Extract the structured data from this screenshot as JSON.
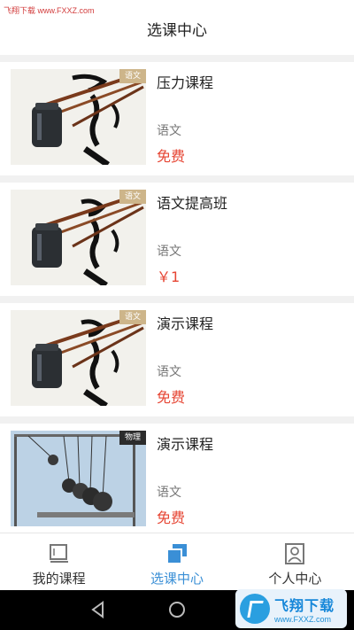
{
  "watermark": {
    "top": "飞翔下载 www.FXXZ.com",
    "bottom_name": "飞翔下载",
    "bottom_url": "www.FXXZ.com"
  },
  "header": {
    "title": "选课中心"
  },
  "courses": [
    {
      "title": "压力课程",
      "subject_tag": "语文",
      "subject": "语文",
      "price": "免费",
      "thumb": "calligraphy"
    },
    {
      "title": "语文提高班",
      "subject_tag": "语文",
      "subject": "语文",
      "price": "￥1",
      "thumb": "calligraphy"
    },
    {
      "title": "演示课程",
      "subject_tag": "语文",
      "subject": "语文",
      "price": "免费",
      "thumb": "calligraphy"
    },
    {
      "title": "演示课程",
      "subject_tag": "物理",
      "subject": "语文",
      "price": "免费",
      "thumb": "newtons-cradle"
    }
  ],
  "tabbar": {
    "tabs": [
      {
        "label": "我的课程",
        "icon": "book-icon",
        "active": false
      },
      {
        "label": "选课中心",
        "icon": "cards-icon",
        "active": true
      },
      {
        "label": "个人中心",
        "icon": "profile-icon",
        "active": false
      }
    ]
  },
  "colors": {
    "accent": "#3a8fd6",
    "price": "#e64533",
    "tag_light": "#cdb58a",
    "tag_dark": "#2c2c2c"
  }
}
